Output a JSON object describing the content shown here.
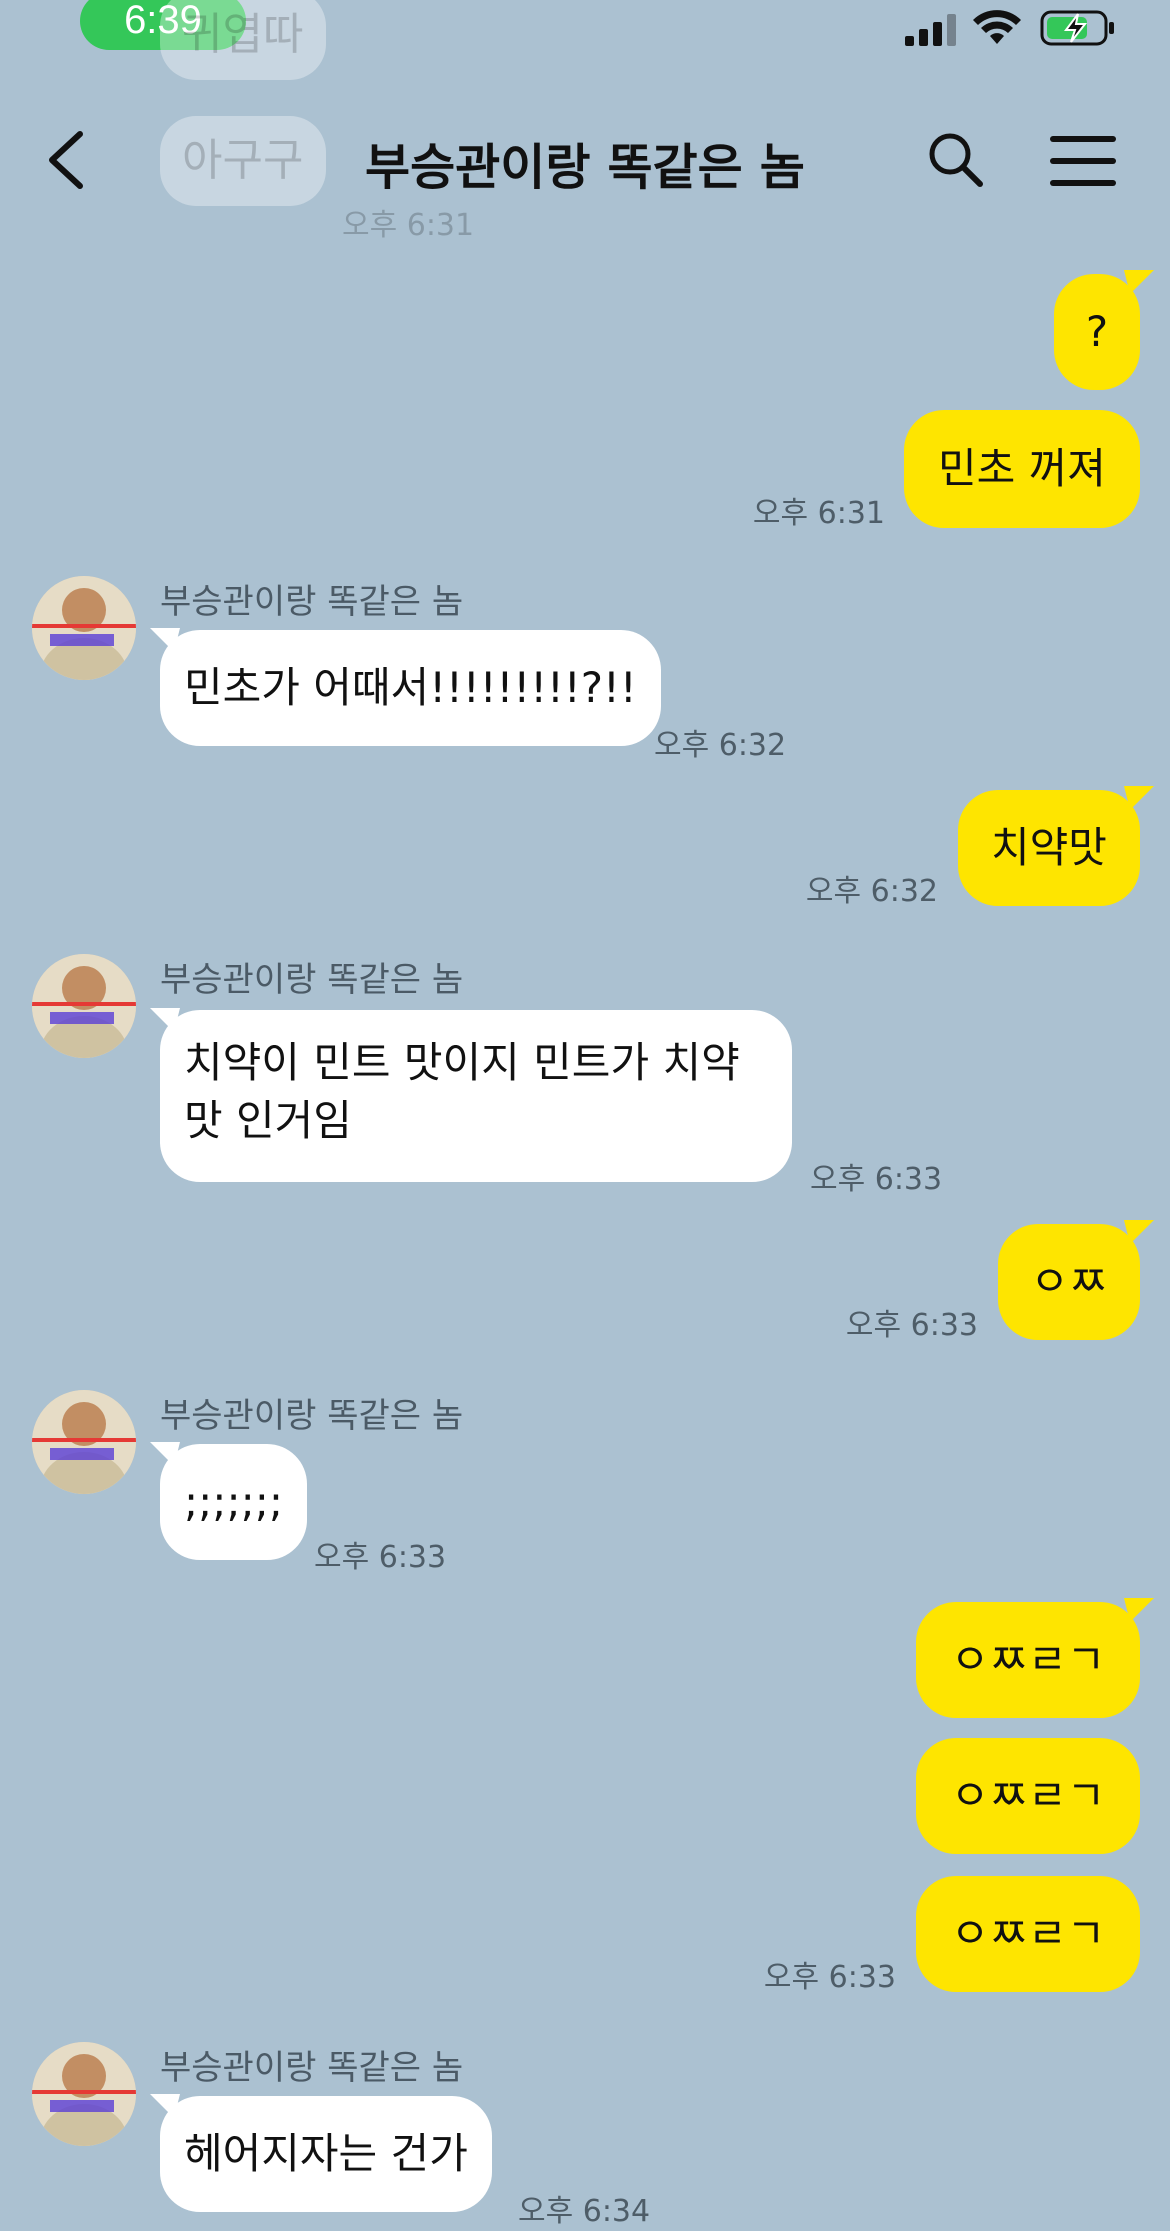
{
  "status_bar": {
    "time": "6:39",
    "signal_icon": "cellular-signal-icon",
    "wifi_icon": "wifi-icon",
    "battery_icon": "battery-charging-icon",
    "battery_color": "#34c759"
  },
  "header": {
    "title": "부승관이랑 똑같은 놈",
    "back_icon": "back-arrow-icon",
    "search_icon": "search-icon",
    "menu_icon": "hamburger-menu-icon"
  },
  "colors": {
    "background": "#abc1d1",
    "my_bubble": "#fee500",
    "other_bubble": "#ffffff"
  },
  "ghost_messages": [
    {
      "text": "귀엽따"
    },
    {
      "text": "아구구",
      "time": "오후 6:31"
    }
  ],
  "messages": [
    {
      "from": "me",
      "text": "?"
    },
    {
      "from": "me",
      "text": "민초 꺼져",
      "time": "오후 6:31"
    },
    {
      "from": "other",
      "sender": "부승관이랑 똑같은 놈",
      "text": "민초가 어때서!!!!!!!!!?!!",
      "time": "오후 6:32"
    },
    {
      "from": "me",
      "text": "치약맛",
      "time": "오후 6:32"
    },
    {
      "from": "other",
      "sender": "부승관이랑 똑같은 놈",
      "text": "치약이 민트 맛이지 민트가 치약 맛 인거임",
      "time": "오후 6:33"
    },
    {
      "from": "me",
      "text": "ㅇㅉ",
      "time": "오후 6:33"
    },
    {
      "from": "other",
      "sender": "부승관이랑 똑같은 놈",
      "text": ";;;;;;;",
      "time": "오후 6:33"
    },
    {
      "from": "me",
      "text": "ㅇㅉㄹㄱ"
    },
    {
      "from": "me",
      "text": "ㅇㅉㄹㄱ"
    },
    {
      "from": "me",
      "text": "ㅇㅉㄹㄱ",
      "time": "오후 6:33"
    },
    {
      "from": "other",
      "sender": "부승관이랑 똑같은 놈",
      "text": "헤어지자는 건가",
      "time": "오후 6:34"
    }
  ]
}
